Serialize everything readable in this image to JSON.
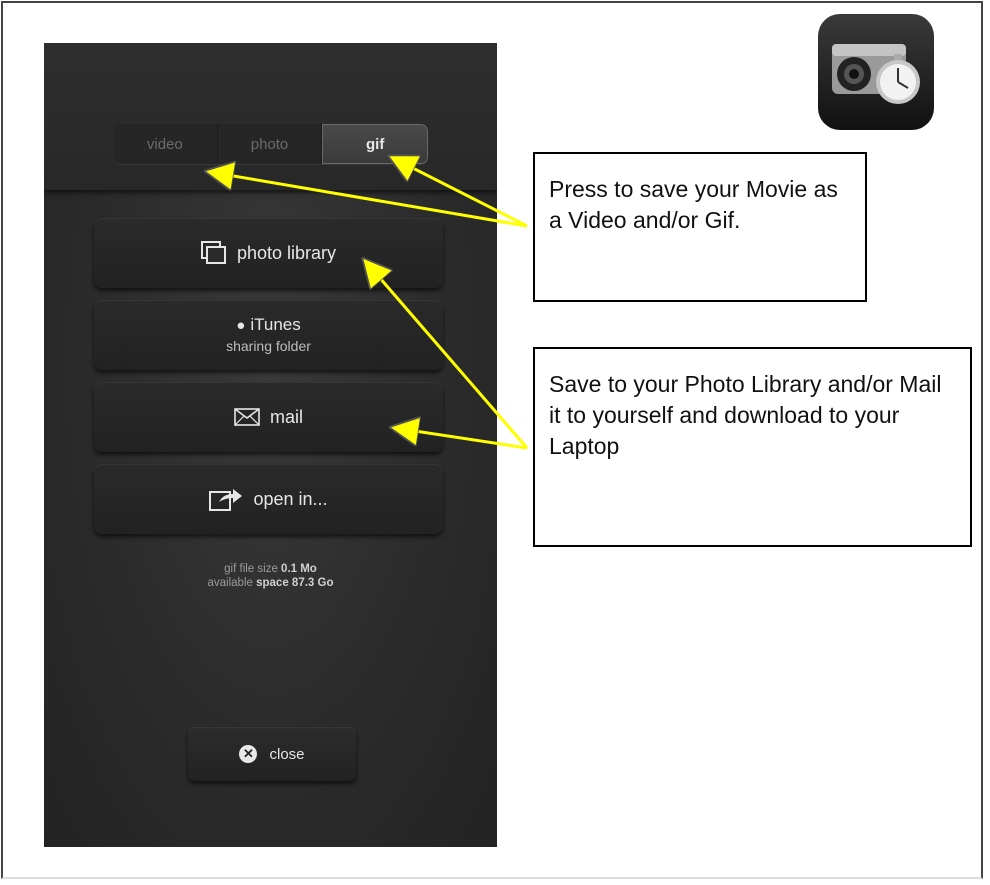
{
  "segmented_control": {
    "options": [
      "video",
      "photo",
      "gif"
    ],
    "selected": "gif"
  },
  "buttons": {
    "photo_library": "photo library",
    "itunes_line1": "iTunes",
    "itunes_line2": "sharing folder",
    "mail": "mail",
    "open_in": "open in...",
    "close": "close"
  },
  "file_info": {
    "size_label": "gif file size",
    "size_value": "0.1 Mo",
    "space_label_1": "available",
    "space_label_2": "space",
    "space_value": "87.3 Go"
  },
  "callouts": {
    "save_format": "Press to save your Movie as a Video and/or Gif.",
    "save_destination": "Save to your Photo Library and/or Mail it to yourself and download to your Laptop"
  },
  "icons": {
    "photo_library": "photo-stack-icon",
    "itunes": "apple-logo-icon",
    "mail": "envelope-icon",
    "open_in": "share-arrow-icon",
    "close": "close-circle-icon",
    "app": "camera-stopwatch-app-icon"
  },
  "colors": {
    "annotation_arrow": "#ffff00",
    "phone_background": "#2b2b2b"
  }
}
